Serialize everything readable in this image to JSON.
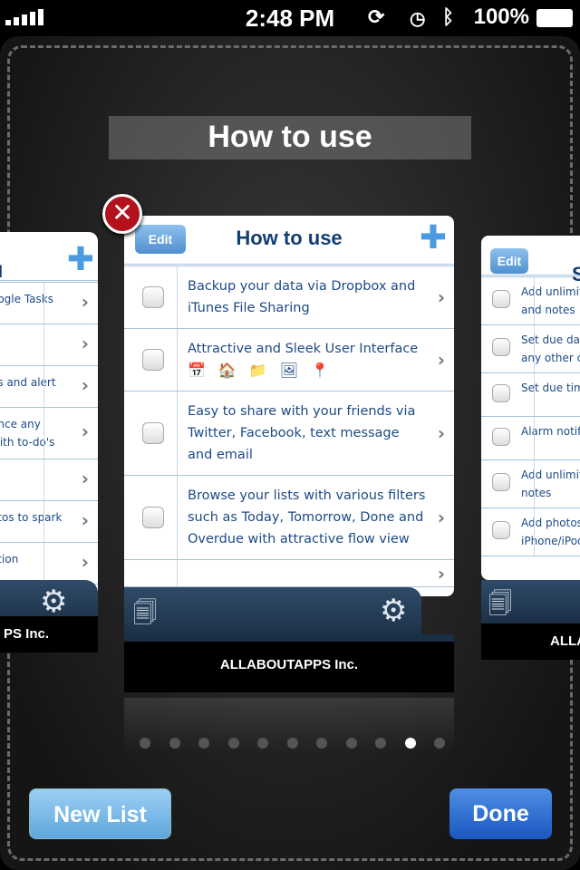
{
  "status_bar": {
    "time": "2:48 PM",
    "battery": "100%",
    "icons": [
      "signal-icon",
      "rotation-lock-icon",
      "alarm-clock-icon",
      "bluetooth-icon",
      "battery-icon"
    ]
  },
  "title": "How to use",
  "left_card": {
    "items": [
      "oogle Tasks",
      "",
      "es and alert",
      "ence any\nwith to-do's",
      "",
      "otos to spark",
      "ation"
    ],
    "company": "PS Inc."
  },
  "center_card": {
    "edit_label": "Edit",
    "title": "How to use",
    "items": [
      {
        "text": "Backup your data via Dropbox and iTunes File Sharing"
      },
      {
        "text": "Attractive and Sleek User Interface",
        "icons": [
          "calendar-icon",
          "home-icon",
          "folder-icon",
          "photo-icon",
          "pin-icon"
        ]
      },
      {
        "text": "Easy to share with your friends via Twitter, Facebook, text message and email"
      },
      {
        "text": "Browse your lists with various filters such as Today, Tomorrow, Done and Overdue with attractive flow view"
      }
    ],
    "company": "ALLABOUTAPPS Inc."
  },
  "right_card": {
    "edit_label": "Edit",
    "title": "S",
    "items": [
      "Add unlimit\nand notes",
      "Set due dat\nany other c",
      "Set due tim",
      "Alarm notif",
      "Add unlimit\nnotes",
      "Add photos\niPhone/iPod"
    ],
    "company": "ALLAB"
  },
  "pagination": {
    "total": 11,
    "current": 10
  },
  "buttons": {
    "new_list": "New List",
    "done": "Done"
  },
  "colors": {
    "title_blue": "#123e73",
    "text_blue": "#1d4a86",
    "done_button": "#1f5fc4",
    "new_list_button": "#6fb2e6",
    "close_red": "#b3121c"
  }
}
